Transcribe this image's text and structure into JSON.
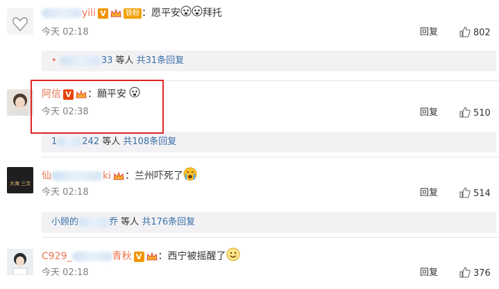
{
  "comments": [
    {
      "name_visible": "yili",
      "text": "：愿平安",
      "text_suffix": "拜托",
      "fans_badge": "铁粉",
      "time": "今天 02:18",
      "reply": "回复",
      "likes": "802",
      "sub": {
        "suffix": "33",
        "more": "等人",
        "link": "共31条回复"
      }
    },
    {
      "name_visible": "阿信",
      "text": "：願平安",
      "time": "今天 02:38",
      "reply": "回复",
      "likes": "510",
      "sub": {
        "prefix": "1",
        "suffix": "242",
        "more": "等人",
        "link": "共108条回复"
      }
    },
    {
      "name_prefix": "仙",
      "name_suffix": "ki",
      "text": "：兰州吓死了",
      "time": "今天 02:18",
      "reply": "回复",
      "likes": "514",
      "sub": {
        "prefix": "小顾的",
        "suffix": "乔",
        "more": "等人",
        "link": "共176条回复"
      }
    },
    {
      "name_prefix": "C929_",
      "name_suffix": "青秋",
      "text": "：西宁被摇醒了",
      "time": "今天 02:18",
      "reply": "回复",
      "likes": "376"
    }
  ],
  "colors": {
    "accent": "#eb7350",
    "highlight": "#e02424",
    "link": "#3a6ea5"
  },
  "icons": [
    "like-icon",
    "verified-v-icon",
    "crown-icon",
    "scared-emoji-icon",
    "crying-emoji-icon",
    "smile-emoji-icon"
  ]
}
